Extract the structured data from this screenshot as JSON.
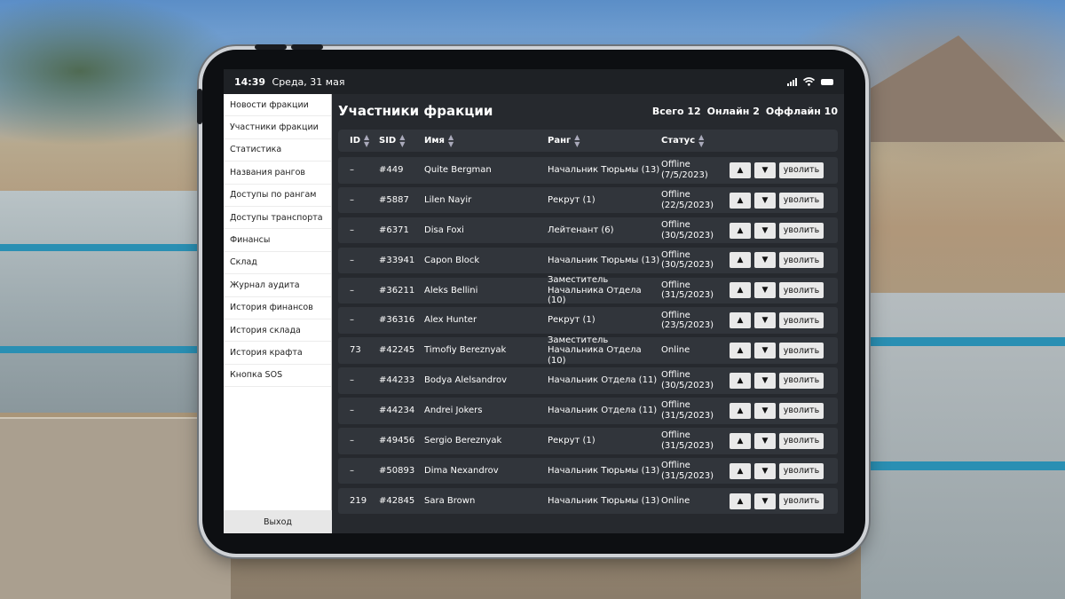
{
  "statusbar": {
    "time": "14:39",
    "date": "Среда, 31 мая"
  },
  "sidebar": {
    "items": [
      {
        "label": "Новости фракции"
      },
      {
        "label": "Участники фракции"
      },
      {
        "label": "Статистика"
      },
      {
        "label": "Названия рангов"
      },
      {
        "label": "Доступы по рангам"
      },
      {
        "label": "Доступы транспорта"
      },
      {
        "label": "Финансы"
      },
      {
        "label": "Склад"
      },
      {
        "label": "Журнал аудита"
      },
      {
        "label": "История финансов"
      },
      {
        "label": "История склада"
      },
      {
        "label": "История крафта"
      },
      {
        "label": "Кнопка SOS"
      }
    ],
    "exit_label": "Выход"
  },
  "main": {
    "title": "Участники фракции",
    "counts": {
      "total": "Всего 12",
      "online": "Онлайн 2",
      "offline": "Оффлайн 10"
    },
    "columns": {
      "id": "ID",
      "sid": "SID",
      "name": "Имя",
      "rank": "Ранг",
      "status": "Статус"
    },
    "sort_icon": "sort-arrows-icon",
    "up_glyph": "▲",
    "down_glyph": "▼",
    "fire_label": "уволить",
    "rows": [
      {
        "id": "–",
        "sid": "#449",
        "name": "Quite Bergman",
        "rank": "Начальник Тюрьмы (13)",
        "status": "Offline (7/5/2023)"
      },
      {
        "id": "–",
        "sid": "#5887",
        "name": "Lilen Nayir",
        "rank": "Рекрут (1)",
        "status": "Offline (22/5/2023)"
      },
      {
        "id": "–",
        "sid": "#6371",
        "name": "Disa Foxi",
        "rank": "Лейтенант (6)",
        "status": "Offline (30/5/2023)"
      },
      {
        "id": "–",
        "sid": "#33941",
        "name": "Capon Block",
        "rank": "Начальник Тюрьмы (13)",
        "status": "Offline (30/5/2023)"
      },
      {
        "id": "–",
        "sid": "#36211",
        "name": "Aleks Bellini",
        "rank": "Заместитель Начальника Отдела (10)",
        "status": "Offline (31/5/2023)"
      },
      {
        "id": "–",
        "sid": "#36316",
        "name": "Alex Hunter",
        "rank": "Рекрут (1)",
        "status": "Offline (23/5/2023)"
      },
      {
        "id": "73",
        "sid": "#42245",
        "name": "Timofiy Bereznyak",
        "rank": "Заместитель Начальника Отдела (10)",
        "status": "Online"
      },
      {
        "id": "–",
        "sid": "#44233",
        "name": "Bodya Alelsandrov",
        "rank": "Начальник Отдела (11)",
        "status": "Offline (30/5/2023)"
      },
      {
        "id": "–",
        "sid": "#44234",
        "name": "Andrei Jokers",
        "rank": "Начальник Отдела (11)",
        "status": "Offline (31/5/2023)"
      },
      {
        "id": "–",
        "sid": "#49456",
        "name": "Sergio Bereznyak",
        "rank": "Рекрут (1)",
        "status": "Offline (31/5/2023)"
      },
      {
        "id": "–",
        "sid": "#50893",
        "name": "Dima Nexandrov",
        "rank": "Начальник Тюрьмы (13)",
        "status": "Offline (31/5/2023)"
      },
      {
        "id": "219",
        "sid": "#42845",
        "name": "Sara Brown",
        "rank": "Начальник Тюрьмы (13)",
        "status": "Online"
      }
    ]
  }
}
